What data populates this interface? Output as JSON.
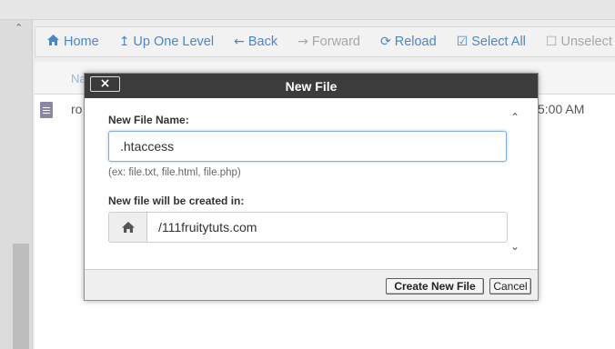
{
  "toolbar": {
    "items": [
      {
        "icon": "home-icon",
        "glyph": "🏠",
        "label": "Home",
        "enabled": true
      },
      {
        "icon": "up-arrow-icon",
        "glyph": "↥",
        "label": "Up One Level",
        "enabled": true
      },
      {
        "icon": "back-arrow-icon",
        "glyph": "←",
        "label": "Back",
        "enabled": true
      },
      {
        "icon": "forward-arrow-icon",
        "glyph": "→",
        "label": "Forward",
        "enabled": false
      },
      {
        "icon": "reload-icon",
        "glyph": "⟳",
        "label": "Reload",
        "enabled": true
      },
      {
        "icon": "checkbox-checked-icon",
        "glyph": "☑",
        "label": "Select All",
        "enabled": true
      },
      {
        "icon": "checkbox-empty-icon",
        "glyph": "☐",
        "label": "Unselect All",
        "enabled": false
      }
    ]
  },
  "file_list": {
    "header_name": "Na",
    "row_name_fragment": "ro",
    "row_time_fragment": "5:00 AM"
  },
  "dialog": {
    "title": "New File",
    "close_glyph": "×",
    "name_label": "New File Name:",
    "name_value": ".htaccess",
    "hint": "(ex: file.txt, file.html, file.php)",
    "location_label": "New file will be created in:",
    "location_value": "/111fruitytuts.com",
    "scroll_up_glyph": "⌃",
    "scroll_down_glyph": "⌄",
    "create_button": "Create New File",
    "cancel_button": "Cancel"
  }
}
